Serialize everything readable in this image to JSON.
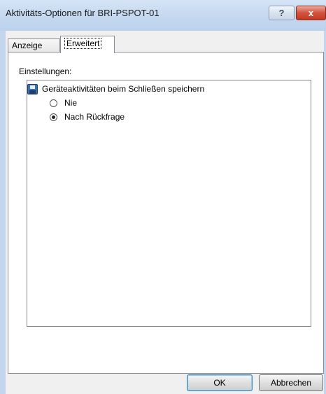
{
  "window": {
    "title": "Aktivitäts-Optionen für BRI-PSPOT-01",
    "help_glyph": "?",
    "close_glyph": "x"
  },
  "tabs": [
    {
      "label": "Anzeige",
      "active": false
    },
    {
      "label": "Erweitert",
      "active": true
    }
  ],
  "settings": {
    "label": "Einstellungen:",
    "group": {
      "icon": "floppy-disk-icon",
      "label": "Geräteaktivitäten beim Schließen speichern",
      "options": [
        {
          "label": "Nie",
          "checked": false
        },
        {
          "label": "Nach Rückfrage",
          "checked": true
        }
      ]
    }
  },
  "buttons": {
    "ok": "OK",
    "cancel": "Abbrechen"
  }
}
